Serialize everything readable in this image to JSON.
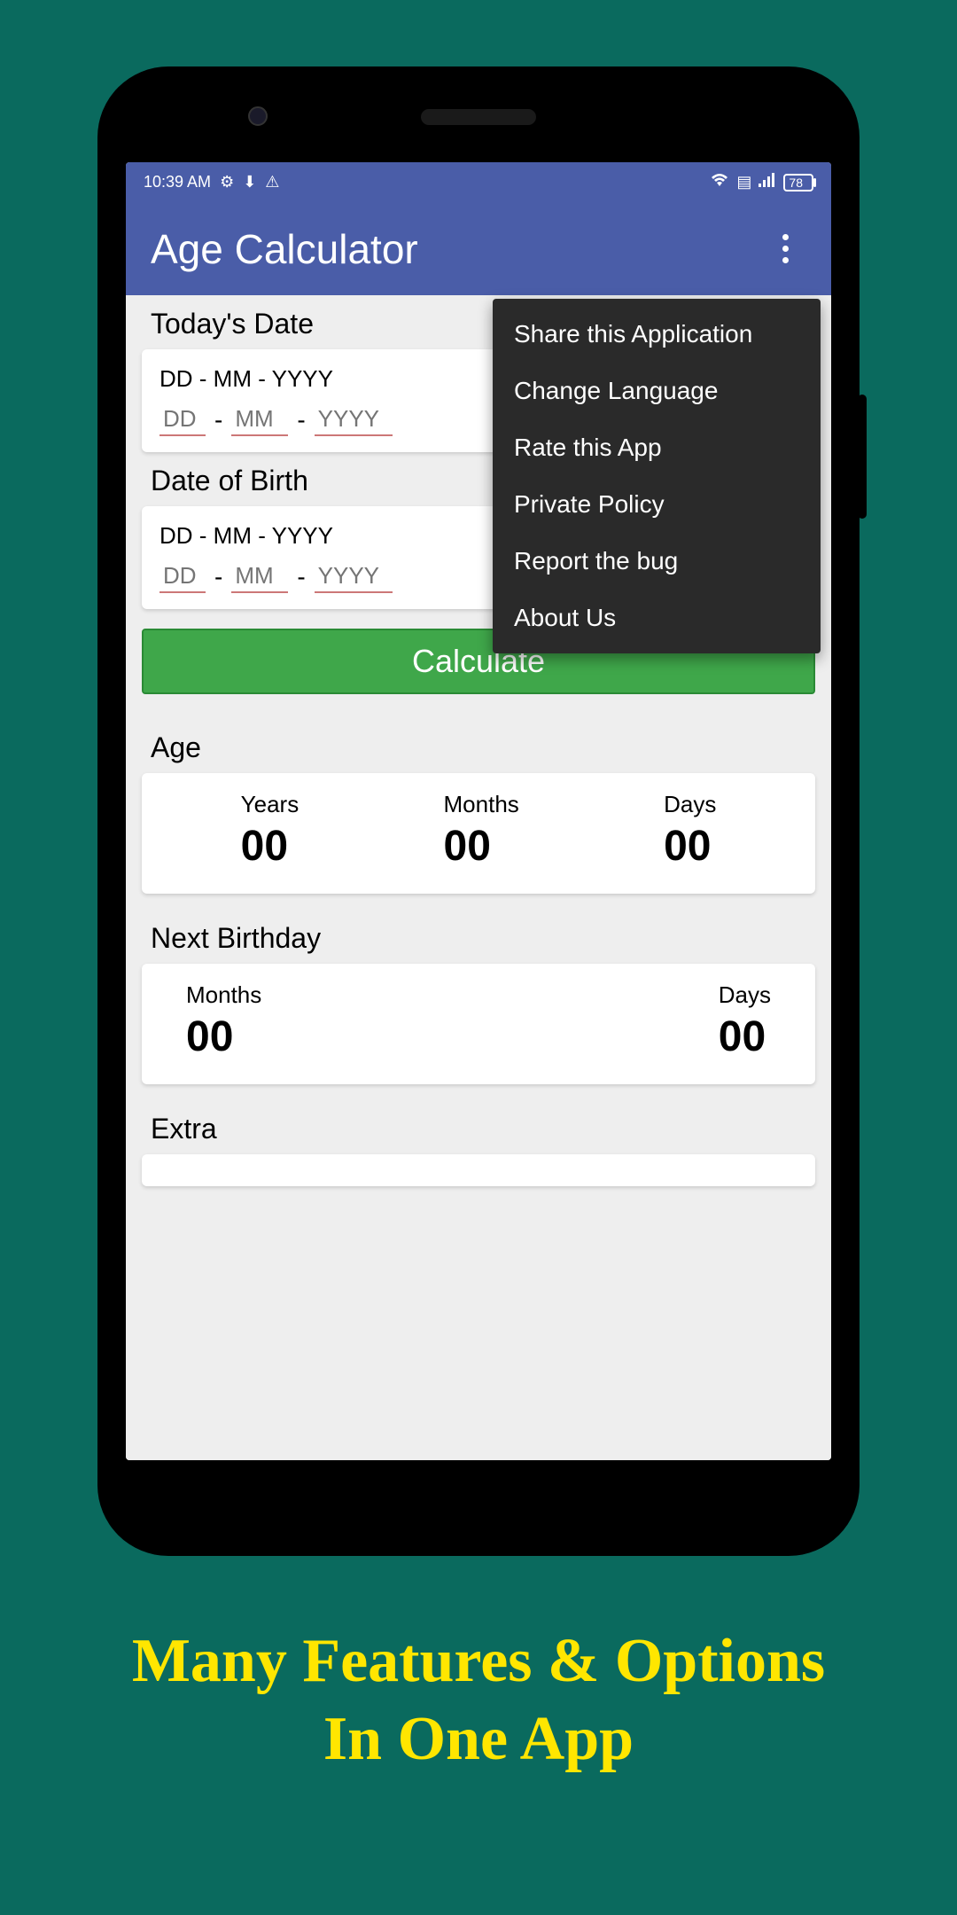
{
  "status": {
    "time": "10:39 AM",
    "battery": "78"
  },
  "app": {
    "title": "Age Calculator"
  },
  "sections": {
    "today": {
      "title": "Today's Date",
      "format": "DD - MM - YYYY",
      "dd_ph": "DD",
      "mm_ph": "MM",
      "yyyy_ph": "YYYY"
    },
    "dob": {
      "title": "Date of Birth",
      "format": "DD - MM - YYYY",
      "dd_ph": "DD",
      "mm_ph": "MM",
      "yyyy_ph": "YYYY"
    },
    "age": {
      "title": "Age",
      "years_label": "Years",
      "months_label": "Months",
      "days_label": "Days",
      "years": "00",
      "months": "00",
      "days": "00"
    },
    "next": {
      "title": "Next Birthday",
      "months_label": "Months",
      "days_label": "Days",
      "months": "00",
      "days": "00"
    },
    "extra": {
      "title": "Extra"
    }
  },
  "calculate_label": "Calculate",
  "menu": {
    "share": "Share this Application",
    "lang": "Change Language",
    "rate": "Rate this App",
    "policy": "Private Policy",
    "bug": "Report the bug",
    "about": "About Us"
  },
  "caption": {
    "line1": "Many Features & Options",
    "line2": "In One App"
  }
}
